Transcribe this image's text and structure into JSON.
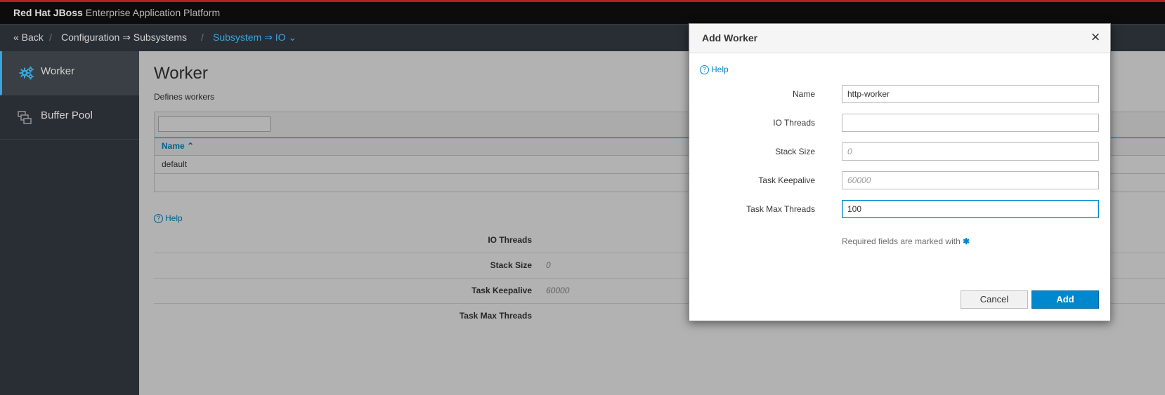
{
  "app": {
    "brand_bold": "Red Hat JBoss",
    "brand_rest": " Enterprise Application Platform"
  },
  "breadcrumb": {
    "back": "« Back",
    "slash1": "/",
    "configuration": "Configuration ⇒ Subsystems",
    "slash2": "/",
    "subsystem": "Subsystem ⇒ IO ⌄"
  },
  "sidebar": {
    "items": [
      {
        "label": "Worker",
        "icon": "gears-icon"
      },
      {
        "label": "Buffer Pool",
        "icon": "buffer-pool-icon"
      }
    ]
  },
  "page": {
    "title": "Worker",
    "description": "Defines workers",
    "table": {
      "header": "Name ⌃",
      "rows": [
        "default"
      ]
    },
    "help": "Help",
    "attributes": [
      {
        "label": "IO Threads",
        "value": ""
      },
      {
        "label": "Stack Size",
        "value": "0"
      },
      {
        "label": "Task Keepalive",
        "value": "60000"
      },
      {
        "label": "Task Max Threads",
        "value": ""
      }
    ]
  },
  "modal": {
    "title": "Add Worker",
    "close": "×",
    "help": "Help",
    "fields": [
      {
        "label": "Name",
        "value": "http-worker",
        "placeholder": ""
      },
      {
        "label": "IO Threads",
        "value": "",
        "placeholder": ""
      },
      {
        "label": "Stack Size",
        "value": "",
        "placeholder": "0"
      },
      {
        "label": "Task Keepalive",
        "value": "",
        "placeholder": "60000"
      },
      {
        "label": "Task Max Threads",
        "value": "100",
        "placeholder": ""
      }
    ],
    "required_note": "Required fields are marked with",
    "required_star": "✱",
    "cancel": "Cancel",
    "add": "Add"
  },
  "colors": {
    "accent": "#0088ce",
    "brand_red": "#b3202a",
    "nav_bg": "#292e34"
  }
}
